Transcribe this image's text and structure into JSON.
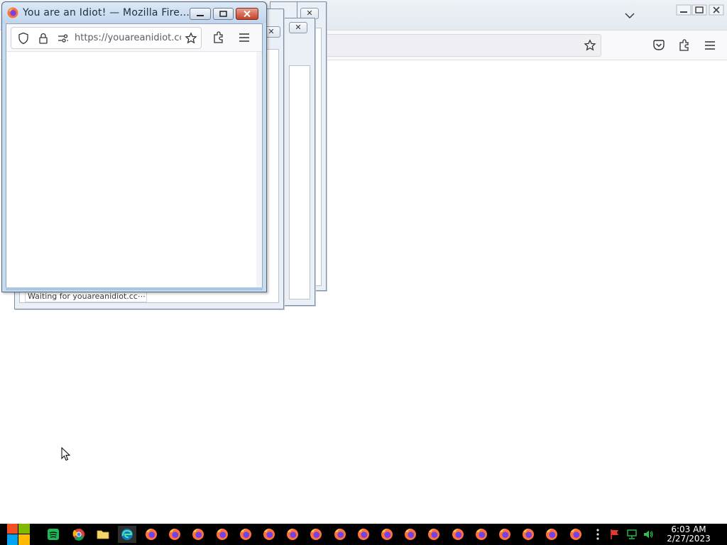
{
  "front_window": {
    "title": "You are an Idiot! — Mozilla Fire...",
    "url": "https://youareanidiot.cc",
    "icons": {
      "shield": "tracking-shield-icon",
      "lock": "lock-icon",
      "permissions": "permissions-icon",
      "bookmark": "star-icon",
      "extensions": "puzzle-icon",
      "menu": "hamburger-menu-icon"
    }
  },
  "back_window": {
    "status_text": "Waiting for youareanidiot.cc⋯"
  },
  "taskbar": {
    "clock_time": "6:03 AM",
    "clock_date": "2/27/2023",
    "firefox_count": 19,
    "colors": {
      "background": "#000000",
      "firefox_orange": "#ff7139",
      "firefox_purple": "#7542e5"
    }
  }
}
